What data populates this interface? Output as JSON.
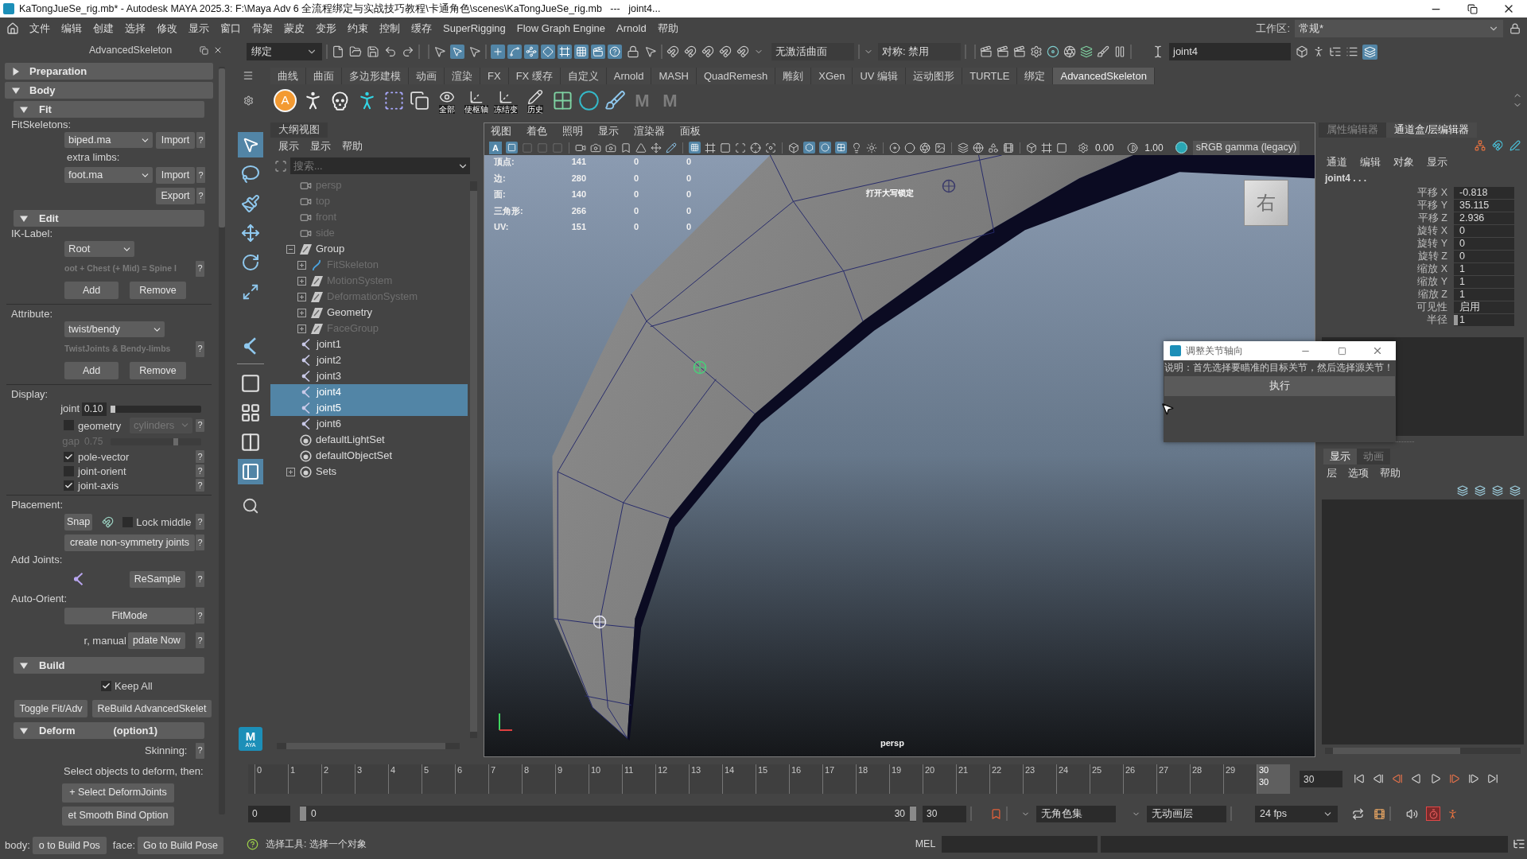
{
  "window": {
    "title": "KaTongJueSe_rig.mb* - Autodesk MAYA 2025.3: F:\\Maya Adv 6 全流程绑定与实战技巧教程\\卡通角色\\scenes\\KaTongJueSe_rig.mb   ---   joint4..."
  },
  "menu_bar": {
    "items": [
      "文件",
      "编辑",
      "创建",
      "选择",
      "修改",
      "显示",
      "窗口",
      "骨架",
      "蒙皮",
      "变形",
      "约束",
      "控制",
      "缓存",
      "SuperRigging",
      "Flow Graph Engine",
      "Arnold",
      "帮助"
    ],
    "workspace_label": "工作区:",
    "workspace": "常规*"
  },
  "advanced_skeleton": {
    "title": "AdvancedSkeleton",
    "sections": [
      {
        "label": "Preparation",
        "expanded": false
      },
      {
        "label": "Body",
        "expanded": true,
        "children": [
          {
            "label": "Fit",
            "expanded": true,
            "rows": [
              {
                "kind": "label",
                "text": "FitSkeletons:"
              },
              {
                "kind": "dropdown_action",
                "value": "biped.ma",
                "action": "Import",
                "help": "?"
              },
              {
                "kind": "caption",
                "text": "extra limbs:"
              },
              {
                "kind": "dropdown_action",
                "value": "foot.ma",
                "action": "Import",
                "help": "?"
              },
              {
                "kind": "action_right",
                "action": "Export",
                "help": "?"
              }
            ]
          },
          {
            "label": "Edit",
            "expanded": true,
            "rows": [
              {
                "kind": "label",
                "text": "IK-Label:"
              },
              {
                "kind": "dropdown",
                "value": "Root"
              },
              {
                "kind": "hint",
                "text": "oot + Chest (+ Mid) = Spine I",
                "disabled": true,
                "help": "?"
              },
              {
                "kind": "button_pair",
                "buttons": [
                  "Add",
                  "Remove"
                ]
              },
              {
                "kind": "divider"
              },
              {
                "kind": "label",
                "text": "Attribute:"
              },
              {
                "kind": "dropdown",
                "value": "twist/bendy"
              },
              {
                "kind": "hint",
                "text": "TwistJoints & Bendy-limbs",
                "disabled": true,
                "help": "?"
              },
              {
                "kind": "button_pair",
                "buttons": [
                  "Add",
                  "Remove"
                ]
              },
              {
                "kind": "divider"
              },
              {
                "kind": "label",
                "text": "Display:"
              },
              {
                "kind": "slider",
                "label": "joint",
                "value": "0.10",
                "level": 0.03,
                "disabled": false
              },
              {
                "kind": "checkbox_dropdown",
                "label": "geometry",
                "checked": false,
                "value": "cylinders",
                "disabled": true,
                "help": "?"
              },
              {
                "kind": "slider",
                "label": "gap",
                "value": "0.75",
                "level": 0.72,
                "disabled": true
              },
              {
                "kind": "checkbox",
                "label": "pole-vector",
                "checked": true,
                "help": "?"
              },
              {
                "kind": "checkbox",
                "label": "joint-orient",
                "checked": false,
                "help": "?"
              },
              {
                "kind": "checkbox",
                "label": "joint-axis",
                "checked": true,
                "help": "?"
              },
              {
                "kind": "divider"
              },
              {
                "kind": "label",
                "text": "Placement:"
              },
              {
                "kind": "snap_row",
                "action": "Snap",
                "label": "Lock middle",
                "checked": false,
                "help": "?"
              },
              {
                "kind": "action_wide",
                "action": "create non-symmetry joints",
                "help": "?"
              },
              {
                "kind": "label",
                "text": "Add Joints:"
              },
              {
                "kind": "icon_action",
                "action": "ReSample",
                "help": "?"
              },
              {
                "kind": "label",
                "text": "Auto-Orient:"
              },
              {
                "kind": "action_wide",
                "action": "FitMode",
                "help": "?"
              },
              {
                "kind": "caption_action",
                "text": "r, manual",
                "action": "pdate Now",
                "help": "?"
              }
            ]
          },
          {
            "label": "Build",
            "expanded": true,
            "rows": [
              {
                "kind": "checkbox_centered",
                "label": "Keep All",
                "checked": true
              },
              {
                "kind": "split_buttons",
                "buttons": [
                  "Toggle Fit/Adv",
                  "ReBuild AdvancedSkelet"
                ]
              }
            ]
          },
          {
            "label": "Deform",
            "note": "(option1)",
            "expanded": true,
            "rows": [
              {
                "kind": "caption_help",
                "text": "Skinning:",
                "help": "?"
              },
              {
                "kind": "note",
                "text": "Select objects to deform, then:"
              },
              {
                "kind": "action_center",
                "action": "+ Select DeformJoints"
              },
              {
                "kind": "action_center",
                "action": "et Smooth Bind Option"
              }
            ]
          }
        ]
      }
    ],
    "footer": [
      {
        "label": "body:",
        "action": "o to Build Pos"
      },
      {
        "label": "face:",
        "action": "Go to Build Pose"
      }
    ]
  },
  "status_line": {
    "menu_set": "绑定",
    "live_surface": "无激活曲面",
    "symmetry": "对称: 禁用",
    "name_field": "joint4"
  },
  "shelf": {
    "tabs": [
      {
        "label": "曲线",
        "selected": false
      },
      {
        "label": "曲面",
        "selected": false
      },
      {
        "label": "多边形建模",
        "selected": false
      },
      {
        "label": "动画",
        "selected": false
      },
      {
        "label": "渲染",
        "selected": false
      },
      {
        "label": "FX",
        "selected": false
      },
      {
        "label": "FX 缓存",
        "selected": false
      },
      {
        "label": "自定义",
        "selected": false
      },
      {
        "label": "Arnold",
        "selected": false
      },
      {
        "label": "MASH",
        "selected": false
      },
      {
        "label": "QuadRemesh",
        "selected": false
      },
      {
        "label": "雕刻",
        "selected": false
      },
      {
        "label": "XGen",
        "selected": false
      },
      {
        "label": "UV 编辑",
        "selected": false
      },
      {
        "label": "运动图形",
        "selected": false
      },
      {
        "label": "TURTLE",
        "selected": false
      },
      {
        "label": "绑定",
        "selected": false
      },
      {
        "label": "AdvancedSkeleton",
        "selected": true
      }
    ],
    "logo_letter": "A",
    "captions": [
      "全部",
      "使枢轴",
      "冻结变",
      "历史"
    ],
    "letters": [
      "M",
      "M"
    ]
  },
  "toolbox": {
    "logo": "M",
    "logo_caption": "AYA"
  },
  "outliner": {
    "title": "大纲视图",
    "menus": [
      "展示",
      "显示",
      "帮助"
    ],
    "search_placeholder": "搜索...",
    "items": [
      {
        "name": "persp",
        "kind": "camera",
        "hidden": true,
        "selected": false
      },
      {
        "name": "top",
        "kind": "camera",
        "hidden": true,
        "selected": false
      },
      {
        "name": "front",
        "kind": "camera",
        "hidden": true,
        "selected": false
      },
      {
        "name": "side",
        "kind": "camera",
        "hidden": true,
        "selected": false
      },
      {
        "name": "Group",
        "kind": "group",
        "hidden": false,
        "selected": false,
        "expanded": true,
        "children": [
          {
            "name": "FitSkeleton",
            "kind": "curve",
            "hidden": true,
            "selected": false,
            "expanded": false
          },
          {
            "name": "MotionSystem",
            "kind": "group",
            "hidden": true,
            "selected": false,
            "expanded": false
          },
          {
            "name": "DeformationSystem",
            "kind": "group",
            "hidden": true,
            "selected": false,
            "expanded": false
          },
          {
            "name": "Geometry",
            "kind": "group",
            "hidden": false,
            "selected": false,
            "expanded": false
          },
          {
            "name": "FaceGroup",
            "kind": "group",
            "hidden": true,
            "selected": false,
            "expanded": false
          }
        ]
      },
      {
        "name": "joint1",
        "kind": "joint",
        "hidden": false,
        "selected": false
      },
      {
        "name": "joint2",
        "kind": "joint",
        "hidden": false,
        "selected": false
      },
      {
        "name": "joint3",
        "kind": "joint",
        "hidden": false,
        "selected": false
      },
      {
        "name": "joint4",
        "kind": "joint",
        "hidden": false,
        "selected": true
      },
      {
        "name": "joint5",
        "kind": "joint",
        "hidden": false,
        "selected": true
      },
      {
        "name": "joint6",
        "kind": "joint",
        "hidden": false,
        "selected": false
      },
      {
        "name": "defaultLightSet",
        "kind": "set",
        "hidden": false,
        "selected": false
      },
      {
        "name": "defaultObjectSet",
        "kind": "set",
        "hidden": false,
        "selected": false
      },
      {
        "name": "Sets",
        "kind": "set",
        "hidden": false,
        "selected": false,
        "expanded": false
      }
    ]
  },
  "viewport": {
    "menus": [
      "视图",
      "着色",
      "照明",
      "显示",
      "渲染器",
      "面板"
    ],
    "toolbar_letter": "A",
    "exposure": "0.00",
    "gamma": "1.00",
    "color_space": "sRGB gamma (legacy)",
    "hud": [
      {
        "label": "顶点:",
        "values": [
          "141",
          "0",
          "0"
        ]
      },
      {
        "label": "边:",
        "values": [
          "280",
          "0",
          "0"
        ]
      },
      {
        "label": "面:",
        "values": [
          "140",
          "0",
          "0"
        ]
      },
      {
        "label": "三角形:",
        "values": [
          "266",
          "0",
          "0"
        ]
      },
      {
        "label": "UV:",
        "values": [
          "151",
          "0",
          "0"
        ]
      }
    ],
    "caps_lock_notice": "打开大写锁定",
    "camera": "persp",
    "view_cube": "右"
  },
  "channel_box": {
    "tabs": [
      {
        "label": "属性编辑器",
        "selected": false
      },
      {
        "label": "通道盒/层编辑器",
        "selected": true
      }
    ],
    "menus": [
      "通道",
      "编辑",
      "对象",
      "显示"
    ],
    "object": "joint4 . . .",
    "channels": [
      {
        "name": "平移 X",
        "value": "-0.818",
        "kind": "field"
      },
      {
        "name": "平移 Y",
        "value": "35.115",
        "kind": "field"
      },
      {
        "name": "平移 Z",
        "value": "2.936",
        "kind": "field"
      },
      {
        "name": "旋转 X",
        "value": "0",
        "kind": "field"
      },
      {
        "name": "旋转 Y",
        "value": "0",
        "kind": "field"
      },
      {
        "name": "旋转 Z",
        "value": "0",
        "kind": "field"
      },
      {
        "name": "缩放 X",
        "value": "1",
        "kind": "field"
      },
      {
        "name": "缩放 Y",
        "value": "1",
        "kind": "field"
      },
      {
        "name": "缩放 Z",
        "value": "1",
        "kind": "field"
      },
      {
        "name": "可见性",
        "value": "启用",
        "kind": "field"
      },
      {
        "name": "半径",
        "value": "1",
        "kind": "slider"
      }
    ]
  },
  "layer_editor": {
    "tabs": [
      {
        "label": "显示",
        "selected": true
      },
      {
        "label": "动画",
        "selected": false
      }
    ],
    "menus": [
      "层",
      "选项",
      "帮助"
    ]
  },
  "dialog": {
    "title": "调整关节轴向",
    "instruction": "说明：首先选择要瞄准的目标关节，然后选择源关节！",
    "button": "执行"
  },
  "time_slider": {
    "ticks": [
      {
        "label": "0",
        "selected": false
      },
      {
        "label": "1",
        "selected": false
      },
      {
        "label": "2",
        "selected": false
      },
      {
        "label": "3",
        "selected": false
      },
      {
        "label": "4",
        "selected": false
      },
      {
        "label": "5",
        "selected": false
      },
      {
        "label": "6",
        "selected": false
      },
      {
        "label": "7",
        "selected": false
      },
      {
        "label": "8",
        "selected": false
      },
      {
        "label": "9",
        "selected": false
      },
      {
        "label": "10",
        "selected": false
      },
      {
        "label": "11",
        "selected": false
      },
      {
        "label": "12",
        "selected": false
      },
      {
        "label": "13",
        "selected": false
      },
      {
        "label": "14",
        "selected": false
      },
      {
        "label": "15",
        "selected": false
      },
      {
        "label": "16",
        "selected": false
      },
      {
        "label": "17",
        "selected": false
      },
      {
        "label": "18",
        "selected": false
      },
      {
        "label": "19",
        "selected": false
      },
      {
        "label": "20",
        "selected": false
      },
      {
        "label": "21",
        "selected": false
      },
      {
        "label": "22",
        "selected": false
      },
      {
        "label": "23",
        "selected": false
      },
      {
        "label": "24",
        "selected": false
      },
      {
        "label": "25",
        "selected": false
      },
      {
        "label": "26",
        "selected": false
      },
      {
        "label": "27",
        "selected": false
      },
      {
        "label": "28",
        "selected": false
      },
      {
        "label": "29",
        "selected": false
      },
      {
        "label": "30",
        "selected": true
      }
    ],
    "current_frame": "30",
    "frame_field": "30"
  },
  "range_slider": {
    "start_field": "0",
    "range_start": "0",
    "range_end": "30",
    "end_field": "30",
    "character_set": "无角色集",
    "animation_layer": "无动画层",
    "fps": "24 fps"
  },
  "command_line": {
    "feedback": "选择工具: 选择一个对象",
    "language": "MEL"
  }
}
